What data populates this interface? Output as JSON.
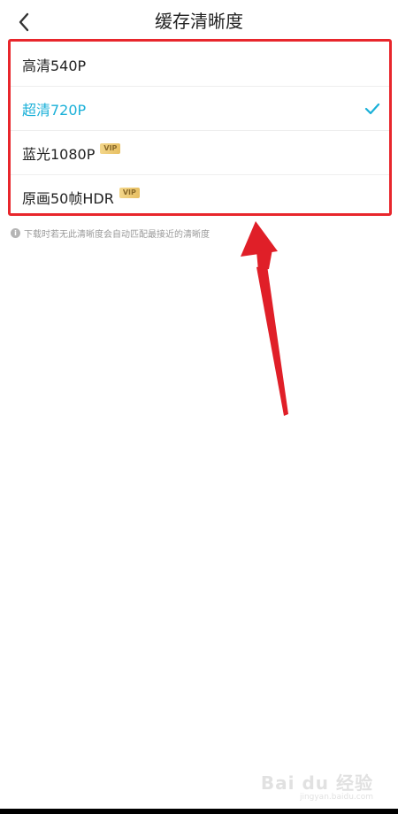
{
  "header": {
    "title": "缓存清晰度"
  },
  "options": [
    {
      "label": "高清540P",
      "selected": false,
      "vip": false
    },
    {
      "label": "超清720P",
      "selected": true,
      "vip": false
    },
    {
      "label": "蓝光1080P",
      "selected": false,
      "vip": true
    },
    {
      "label": "原画50帧HDR",
      "selected": false,
      "vip": true
    }
  ],
  "badge": {
    "vip_label": "VIP"
  },
  "hint": {
    "icon": "i",
    "text": "下载时若无此清晰度会自动匹配最接近的清晰度"
  },
  "watermark": {
    "main": "Bai du 经验",
    "sub": "jingyan.baidu.com"
  },
  "colors": {
    "accent": "#1ab0d8",
    "annotation_red": "#e8262c",
    "vip_gold": "#e7bf62"
  }
}
